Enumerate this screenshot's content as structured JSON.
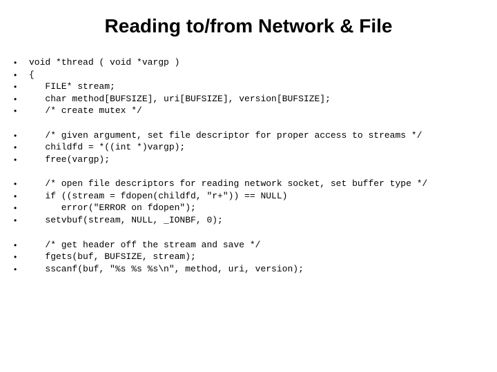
{
  "title": "Reading to/from Network & File",
  "groups": [
    [
      "void *thread ( void *vargp )",
      "{",
      "   FILE* stream;",
      "   char method[BUFSIZE], uri[BUFSIZE], version[BUFSIZE];",
      "   /* create mutex */"
    ],
    [
      "   /* given argument, set file descriptor for proper access to streams */",
      "   childfd = *((int *)vargp);",
      "   free(vargp);"
    ],
    [
      "   /* open file descriptors for reading network socket, set buffer type */",
      "   if ((stream = fdopen(childfd, \"r+\")) == NULL)",
      "      error(\"ERROR on fdopen\");",
      "   setvbuf(stream, NULL, _IONBF, 0);"
    ],
    [
      "   /* get header off the stream and save */",
      "   fgets(buf, BUFSIZE, stream);",
      "   sscanf(buf, \"%s %s %s\\n\", method, uri, version);"
    ]
  ]
}
